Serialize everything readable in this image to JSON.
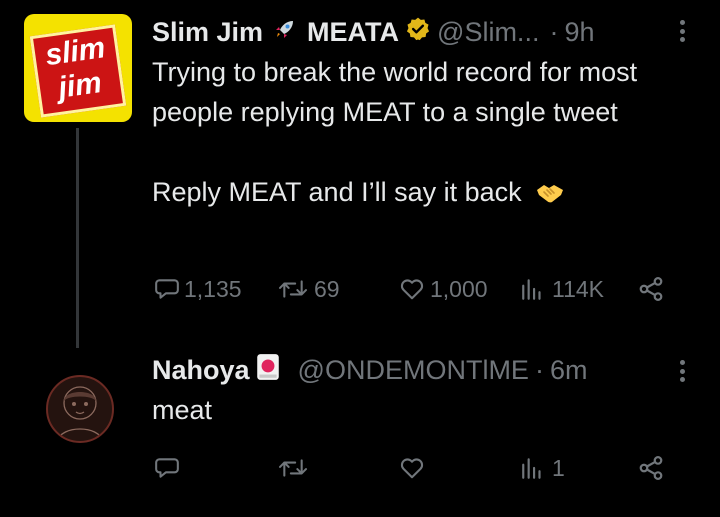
{
  "tweet1": {
    "display_name": "Slim Jim",
    "display_name_suffix": "MEATA",
    "handle": "@Slim...",
    "separator": "·",
    "time": "9h",
    "logo_text": [
      "slim",
      "jim"
    ],
    "body": [
      "Trying to break the world record for most people replying MEAT to a single tweet",
      "Reply MEAT and I’ll say it back"
    ],
    "stats": {
      "replies": "1,135",
      "reposts": "69",
      "likes": "1,000",
      "views": "114K"
    }
  },
  "tweet2": {
    "display_name": "Nahoya",
    "handle": "@ONDEMONTlME",
    "separator": "·",
    "time": "6m",
    "body": "meat",
    "stats": {
      "views": "1"
    }
  },
  "colors": {
    "background": "#000000",
    "text": "#e7e9ea",
    "muted": "#71767b",
    "verified_gold": "#e2b719",
    "logo_yellow": "#f4e200",
    "logo_red": "#cc1414"
  },
  "icons": [
    "rocket-icon",
    "verified-badge-icon",
    "handshake-emoji-icon",
    "card-emoji-icon",
    "more-icon",
    "reply-icon",
    "repost-icon",
    "like-icon",
    "views-icon",
    "share-icon"
  ]
}
